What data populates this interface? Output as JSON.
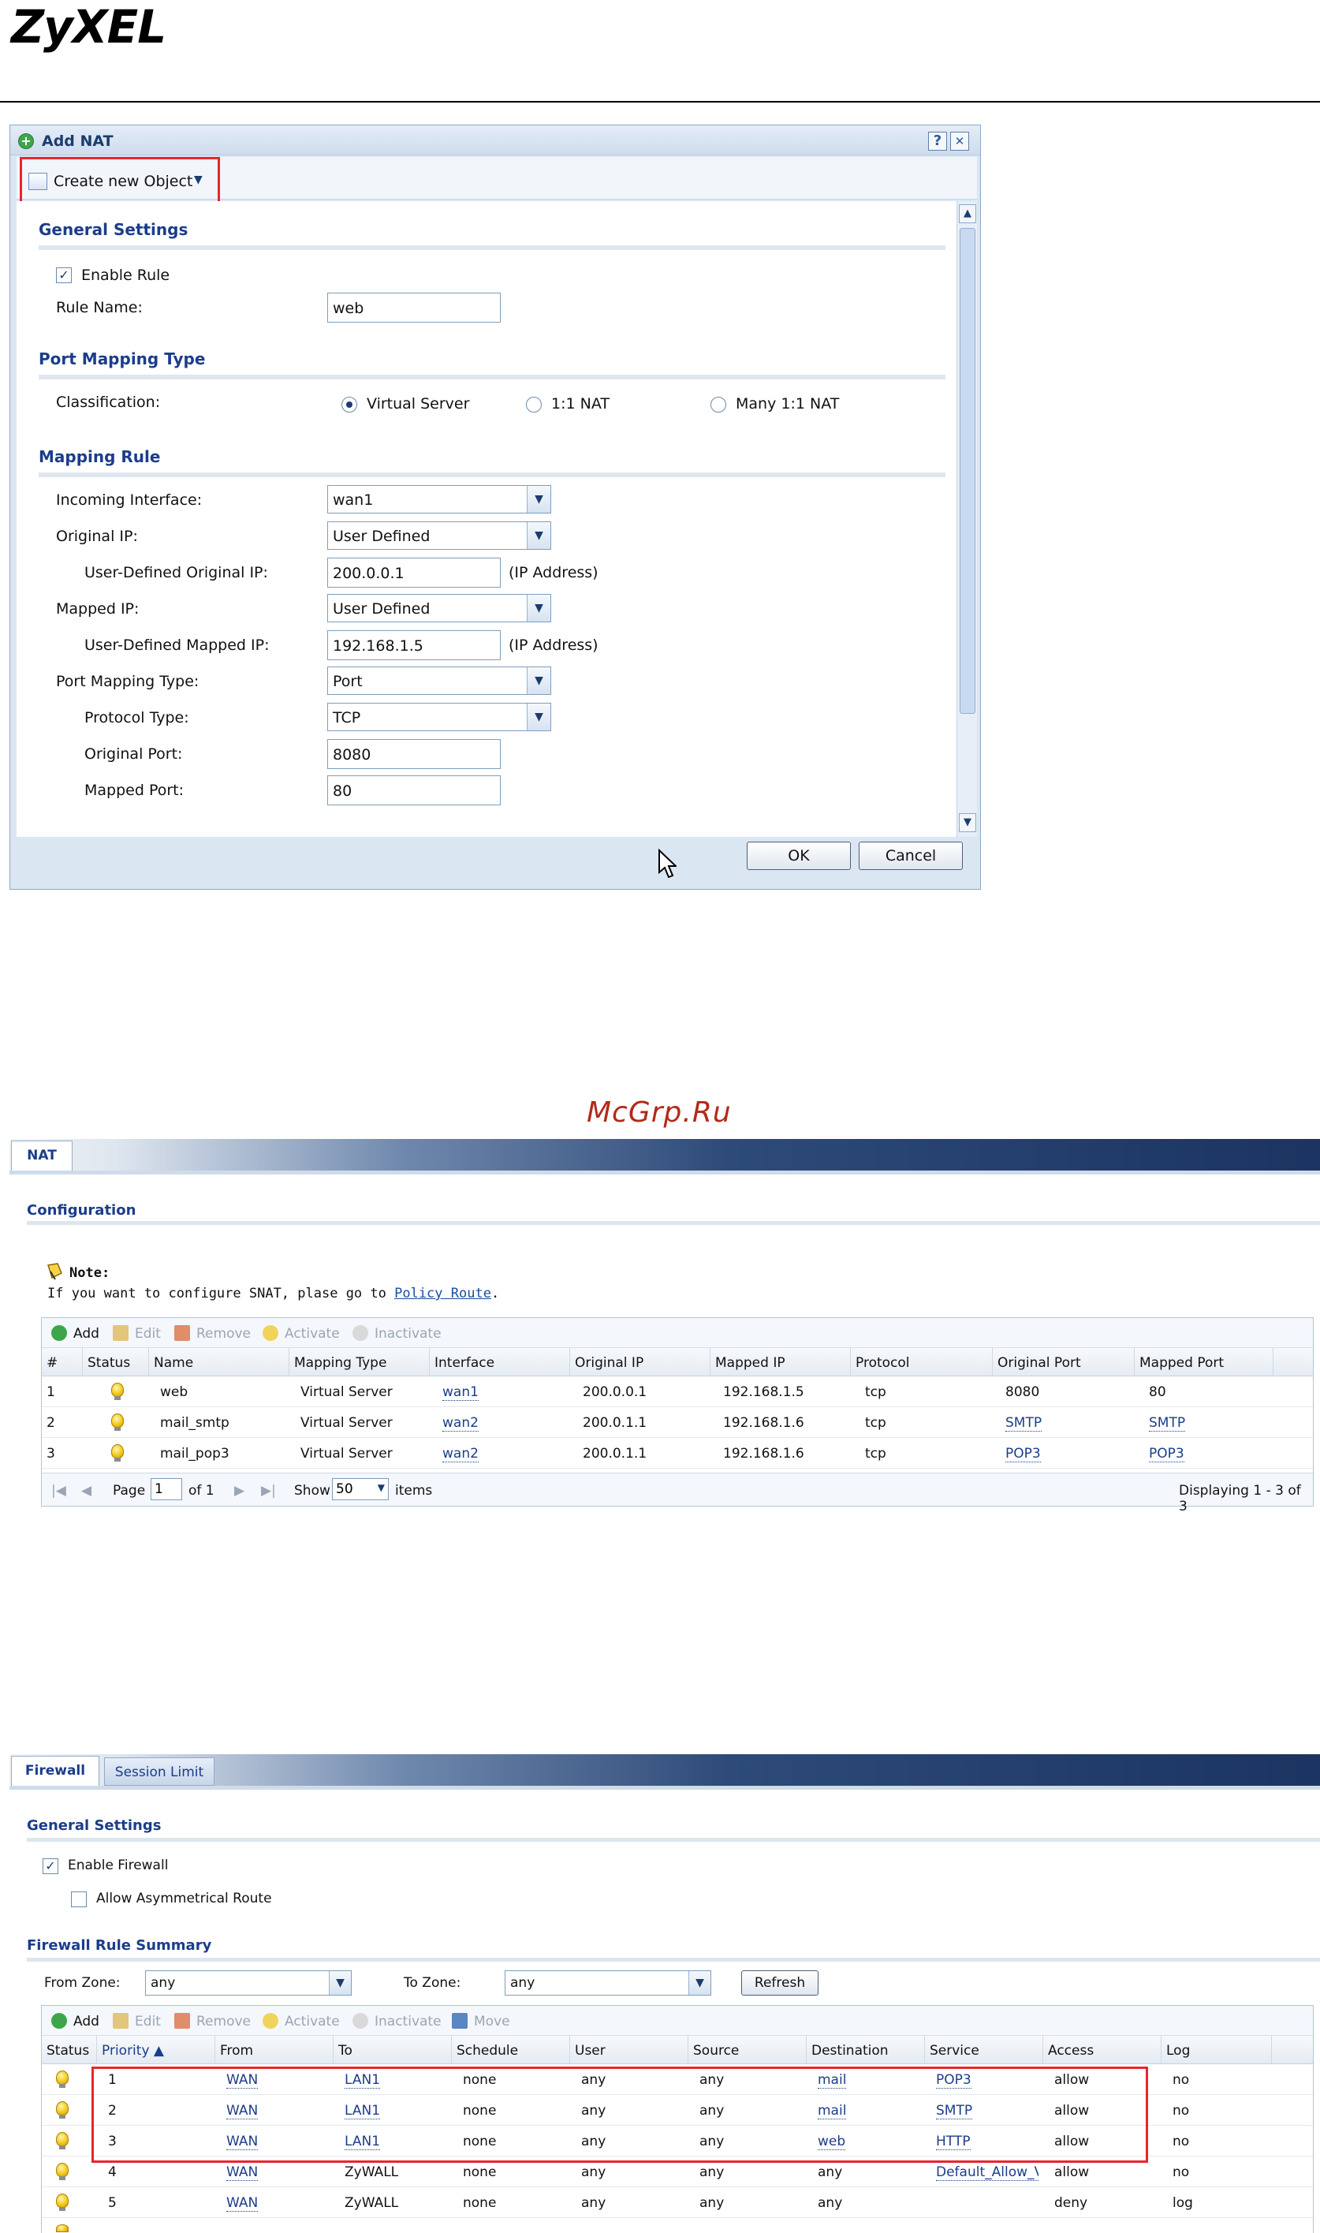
{
  "header": {
    "logo": "ZyXEL"
  },
  "dialog": {
    "title": "Add NAT",
    "help_label": "?",
    "close_label": "✕",
    "create_object_label": "Create new Object",
    "general_settings": {
      "title": "General Settings",
      "enable_rule_label": "Enable Rule",
      "enable_rule_checked": true,
      "rule_name_label": "Rule Name:",
      "rule_name_value": "web"
    },
    "port_mapping_type": {
      "title": "Port Mapping Type",
      "classification_label": "Classification:",
      "options": [
        "Virtual Server",
        "1:1 NAT",
        "Many 1:1 NAT"
      ],
      "selected": "Virtual Server"
    },
    "mapping_rule": {
      "title": "Mapping Rule",
      "incoming_interface_label": "Incoming Interface:",
      "incoming_interface_value": "wan1",
      "original_ip_label": "Original IP:",
      "original_ip_value": "User Defined",
      "user_defined_original_ip_label": "User-Defined Original IP:",
      "user_defined_original_ip_value": "200.0.0.1",
      "ip_address_hint": "(IP Address)",
      "mapped_ip_label": "Mapped IP:",
      "mapped_ip_value": "User Defined",
      "user_defined_mapped_ip_label": "User-Defined Mapped IP:",
      "user_defined_mapped_ip_value": "192.168.1.5",
      "port_mapping_type_label": "Port Mapping Type:",
      "port_mapping_type_value": "Port",
      "protocol_type_label": "Protocol Type:",
      "protocol_type_value": "TCP",
      "original_port_label": "Original Port:",
      "original_port_value": "8080",
      "mapped_port_label": "Mapped Port:",
      "mapped_port_value": "80"
    },
    "ok_label": "OK",
    "cancel_label": "Cancel"
  },
  "watermark": "McGrp.Ru",
  "nat": {
    "tab": "NAT",
    "section_title": "Configuration",
    "note_label": "Note:",
    "note_text": "If you want to configure SNAT, plase go to ",
    "note_link": "Policy Route",
    "note_end": ".",
    "toolbar": [
      "Add",
      "Edit",
      "Remove",
      "Activate",
      "Inactivate"
    ],
    "columns": [
      "#",
      "Status",
      "Name",
      "Mapping Type",
      "Interface",
      "Original IP",
      "Mapped IP",
      "Protocol",
      "Original Port",
      "Mapped Port"
    ],
    "rows": [
      {
        "num": "1",
        "name": "web",
        "mapping_type": "Virtual Server",
        "interface": "wan1",
        "original_ip": "200.0.0.1",
        "mapped_ip": "192.168.1.5",
        "protocol": "tcp",
        "original_port": "8080",
        "mapped_port": "80"
      },
      {
        "num": "2",
        "name": "mail_smtp",
        "mapping_type": "Virtual Server",
        "interface": "wan2",
        "original_ip": "200.0.1.1",
        "mapped_ip": "192.168.1.6",
        "protocol": "tcp",
        "original_port": "SMTP",
        "mapped_port": "SMTP"
      },
      {
        "num": "3",
        "name": "mail_pop3",
        "mapping_type": "Virtual Server",
        "interface": "wan2",
        "original_ip": "200.0.1.1",
        "mapped_ip": "192.168.1.6",
        "protocol": "tcp",
        "original_port": "POP3",
        "mapped_port": "POP3"
      }
    ],
    "pager": {
      "page_label": "Page",
      "page_value": "1",
      "of_label": "of 1",
      "show_label": "Show",
      "show_value": "50",
      "items_label": "items",
      "displaying": "Displaying 1 - 3 of 3"
    }
  },
  "firewall": {
    "tabs": [
      "Firewall",
      "Session Limit"
    ],
    "general_settings_title": "General Settings",
    "enable_firewall_label": "Enable Firewall",
    "enable_firewall_checked": true,
    "allow_asym_label": "Allow Asymmetrical Route",
    "allow_asym_checked": false,
    "summary_title": "Firewall Rule Summary",
    "from_zone_label": "From Zone:",
    "from_zone_value": "any",
    "to_zone_label": "To Zone:",
    "to_zone_value": "any",
    "refresh_label": "Refresh",
    "toolbar": [
      "Add",
      "Edit",
      "Remove",
      "Activate",
      "Inactivate",
      "Move"
    ],
    "columns": [
      "Status",
      "Priority ▲",
      "From",
      "To",
      "Schedule",
      "User",
      "Source",
      "Destination",
      "Service",
      "Access",
      "Log"
    ],
    "rows": [
      {
        "priority": "1",
        "from": "WAN",
        "to": "LAN1",
        "schedule": "none",
        "user": "any",
        "source": "any",
        "destination": "mail",
        "service": "POP3",
        "access": "allow",
        "log": "no"
      },
      {
        "priority": "2",
        "from": "WAN",
        "to": "LAN1",
        "schedule": "none",
        "user": "any",
        "source": "any",
        "destination": "mail",
        "service": "SMTP",
        "access": "allow",
        "log": "no"
      },
      {
        "priority": "3",
        "from": "WAN",
        "to": "LAN1",
        "schedule": "none",
        "user": "any",
        "source": "any",
        "destination": "web",
        "service": "HTTP",
        "access": "allow",
        "log": "no"
      },
      {
        "priority": "4",
        "from": "WAN",
        "to": "ZyWALL",
        "schedule": "none",
        "user": "any",
        "source": "any",
        "destination": "any",
        "service": "Default_Allow_V",
        "access": "allow",
        "log": "no"
      },
      {
        "priority": "5",
        "from": "WAN",
        "to": "ZyWALL",
        "schedule": "none",
        "user": "any",
        "source": "any",
        "destination": "any",
        "service": "",
        "access": "deny",
        "log": "log"
      }
    ]
  },
  "colors": {
    "highlight": "#e8262c",
    "title_blue": "#1b3d8a"
  }
}
